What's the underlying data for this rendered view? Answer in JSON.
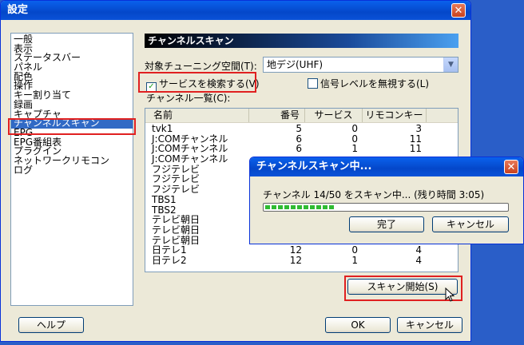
{
  "window": {
    "title": "設定",
    "close_glyph": "✕"
  },
  "sidebar": {
    "items": [
      "一般",
      "表示",
      "ステータスバー",
      "パネル",
      "配色",
      "操作",
      "キー割り当て",
      "録画",
      "キャプチャ",
      "チャンネルスキャン",
      "EPG",
      "EPG番組表",
      "プラグイン",
      "ネットワークリモコン",
      "ログ"
    ],
    "selected": "チャンネルスキャン"
  },
  "panel": {
    "header": "チャンネルスキャン",
    "tuning_space_label": "対象チューニング空間(T):",
    "tuning_space_value": "地デジ(UHF)",
    "search_services_label": "サービスを検索する(V)",
    "search_services_checked": true,
    "ignore_signal_label": "信号レベルを無視する(L)",
    "ignore_signal_checked": false,
    "channel_list_label": "チャンネル一覧(C):",
    "scan_button": "スキャン開始(S)"
  },
  "channel_table": {
    "columns": [
      "名前",
      "番号",
      "サービス",
      "リモコンキー"
    ],
    "rows": [
      [
        "tvk1",
        "5",
        "0",
        "3"
      ],
      [
        "J:COMチャンネル",
        "6",
        "0",
        "11"
      ],
      [
        "J:COMチャンネル",
        "6",
        "1",
        "11"
      ],
      [
        "J:COMチャンネル",
        "",
        "",
        ""
      ],
      [
        "フジテレビ",
        "",
        "",
        ""
      ],
      [
        "フジテレビ",
        "",
        "",
        ""
      ],
      [
        "フジテレビ",
        "",
        "",
        ""
      ],
      [
        "TBS1",
        "",
        "",
        ""
      ],
      [
        "TBS2",
        "",
        "",
        ""
      ],
      [
        "テレビ朝日",
        "",
        "",
        ""
      ],
      [
        "テレビ朝日",
        "",
        "",
        ""
      ],
      [
        "テレビ朝日",
        "",
        "",
        ""
      ],
      [
        "日テレ1",
        "12",
        "0",
        "4"
      ],
      [
        "日テレ2",
        "12",
        "1",
        "4"
      ]
    ]
  },
  "footer": {
    "help": "ヘルプ",
    "ok": "OK",
    "cancel": "キャンセル"
  },
  "dialog": {
    "title": "チャンネルスキャン中...",
    "status": "チャンネル 14/50 をスキャン中... (残り時間 3:05)",
    "progress": 0.28,
    "done_button": "完了",
    "cancel_button": "キャンセル"
  }
}
